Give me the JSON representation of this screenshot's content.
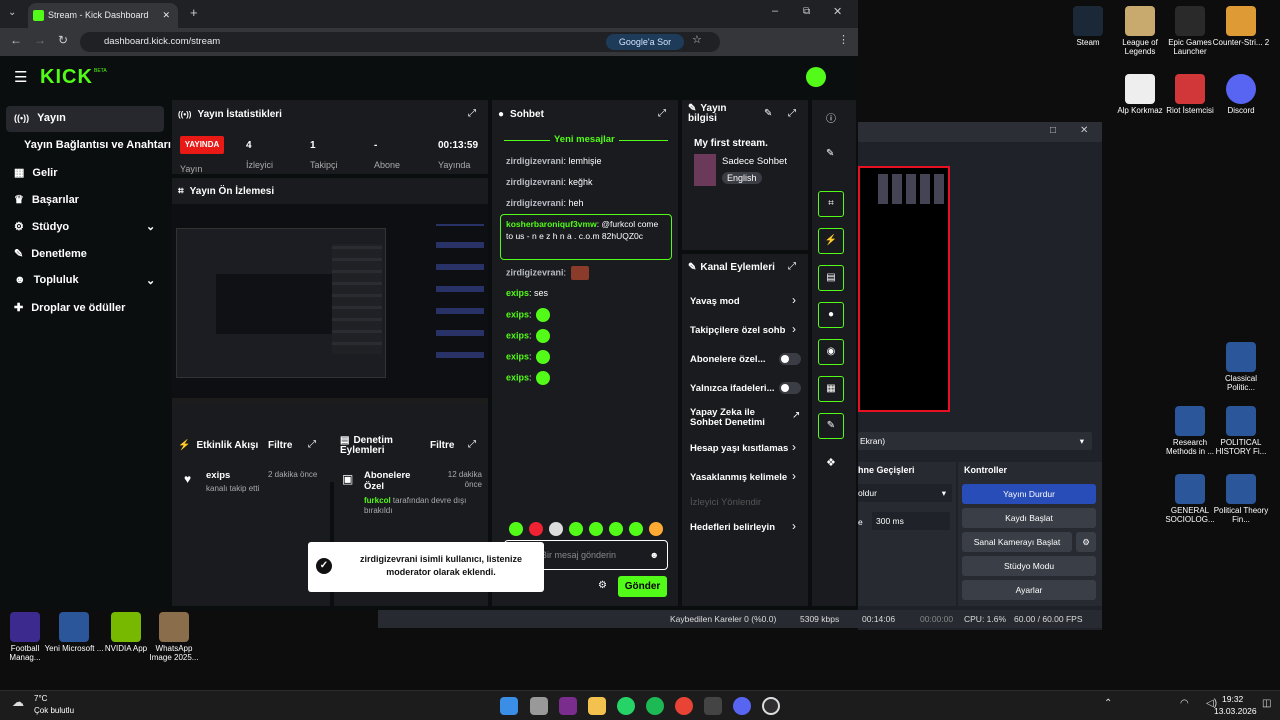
{
  "browser": {
    "tab_title": "Stream - Kick Dashboard",
    "url": "dashboard.kick.com/stream",
    "ask_google": "Google'a Sor"
  },
  "kick": {
    "logo": "KICK",
    "logo_badge": "BETA",
    "sidebar": [
      {
        "label": "Yayın",
        "icon": "broadcast-icon",
        "active": true
      },
      {
        "label": "Yayın Bağlantısı ve Anahtarı",
        "icon": "",
        "active": false
      },
      {
        "label": "Gelir",
        "icon": "chart-icon",
        "active": false
      },
      {
        "label": "Başarılar",
        "icon": "trophy-icon",
        "active": false
      },
      {
        "label": "Stüdyo",
        "icon": "gear-icon",
        "active": false
      },
      {
        "label": "Denetleme",
        "icon": "wrench-icon",
        "active": false
      },
      {
        "label": "Topluluk",
        "icon": "people-icon",
        "active": false
      },
      {
        "label": "Droplar ve ödüller",
        "icon": "gift-icon",
        "active": false
      }
    ],
    "stats": {
      "title": "Yayın İstatistikleri",
      "live_badge": "YAYINDA",
      "live_label": "Yayın",
      "viewers_value": "4",
      "viewers_label": "İzleyici",
      "followers_value": "1",
      "followers_label": "Takipçi",
      "subs_value": "-",
      "subs_label": "Abone",
      "uptime_value": "00:13:59",
      "uptime_label": "Yayında"
    },
    "preview": {
      "title": "Yayın Ön İzlemesi"
    },
    "activity": {
      "title": "Etkinlik Akışı",
      "filter": "Filtre",
      "user": "exips",
      "time": "2 dakika önce",
      "text": "kanalı takip etti"
    },
    "modlog": {
      "title": "Denetim Eylemleri",
      "filter": "Filtre",
      "event": "Abonelere Özel",
      "time": "12 dakika önce",
      "user": "furkcol",
      "text": "tarafından devre dışı bırakıldı"
    },
    "chat": {
      "title": "Sohbet",
      "new_messages": "Yeni mesajlar",
      "messages": [
        {
          "user": "zirdigizevrani",
          "text": "lemhişie"
        },
        {
          "user": "zirdigizevrani",
          "text": "keğhk"
        },
        {
          "user": "zirdigizevrani",
          "text": "heh"
        },
        {
          "user": "zirdigizevrani",
          "text": ""
        },
        {
          "user": "exips",
          "text": "ses"
        },
        {
          "user": "exips",
          "text": ""
        },
        {
          "user": "exips",
          "text": ""
        },
        {
          "user": "exips",
          "text": ""
        },
        {
          "user": "exips",
          "text": ""
        }
      ],
      "highlight_user": "kosherbaroniquf3vmw",
      "highlight_text": "@furkcol come to us - n e z h n a . c.o.m 82hUQZ0c",
      "input_placeholder": "Bir mesaj gönderin",
      "send": "Gönder",
      "toast": "zirdigizevrani isimli kullanıcı, listenize moderator olarak eklendi."
    },
    "info": {
      "title": "Yayın bilgisi",
      "stream_title": "My first stream.",
      "category": "Sadece Sohbet",
      "language": "English"
    },
    "channel_actions": {
      "title": "Kanal Eylemleri",
      "items": [
        {
          "label": "Yavaş mod",
          "control": "chevron"
        },
        {
          "label": "Takipçilere özel sohb",
          "control": "chevron"
        },
        {
          "label": "Abonelere özel...",
          "control": "toggle"
        },
        {
          "label": "Yalnızca ifadeleri...",
          "control": "toggle"
        },
        {
          "label": "Yapay Zeka ile Sohbet Denetimi",
          "control": "external"
        },
        {
          "label": "Hesap yaşı kısıtlamas",
          "control": "chevron"
        },
        {
          "label": "Yasaklanmış kelimele",
          "control": "chevron"
        },
        {
          "label": "İzleyici Yönlendir",
          "control": "disabled"
        },
        {
          "label": "Hedefleri belirleyin",
          "control": "chevron"
        }
      ]
    }
  },
  "obs": {
    "source_select": "Ekran)",
    "transitions_title": "hne Geçişleri",
    "transition_value": "oldur",
    "duration_label": "e",
    "duration_value": "300 ms",
    "controls_title": "Kontroller",
    "buttons": [
      "Yayını Durdur",
      "Kaydı Başlat",
      "Sanal Kamerayı Başlat",
      "Stüdyo Modu",
      "Ayarlar"
    ],
    "status_dropped": "Kaybedilen Kareler 0 (%0.0)",
    "status_kbps": "5309 kbps",
    "status_time1": "00:14:06",
    "status_time2": "00:00:00",
    "status_cpu": "CPU: 1.6%",
    "status_fps": "60.00 / 60.00 FPS"
  },
  "desktop": {
    "icons": [
      {
        "label": "Steam"
      },
      {
        "label": "League of Legends"
      },
      {
        "label": "Epic Games Launcher"
      },
      {
        "label": "Counter-Stri... 2"
      },
      {
        "label": "Alp Korkmaz"
      },
      {
        "label": "Riot İstemcisi"
      },
      {
        "label": "Discord"
      },
      {
        "label": "Classical Politic..."
      },
      {
        "label": "Research Methods in ..."
      },
      {
        "label": "POLITICAL HISTORY Fi..."
      },
      {
        "label": "GENERAL SOCIOLOG..."
      },
      {
        "label": "Political Theory Fin..."
      },
      {
        "label": "Football Manag..."
      },
      {
        "label": "Yeni Microsoft ..."
      },
      {
        "label": "NVIDIA App"
      },
      {
        "label": "WhatsApp Image 2025..."
      }
    ]
  },
  "taskbar": {
    "weather_temp": "7°C",
    "weather_text": "Çok bulutlu",
    "time": "19:32",
    "date": "13.03.2026"
  },
  "colors": {
    "kick_green": "#53fc18",
    "live_red": "#e91916",
    "obs_blue": "#284cb8"
  }
}
